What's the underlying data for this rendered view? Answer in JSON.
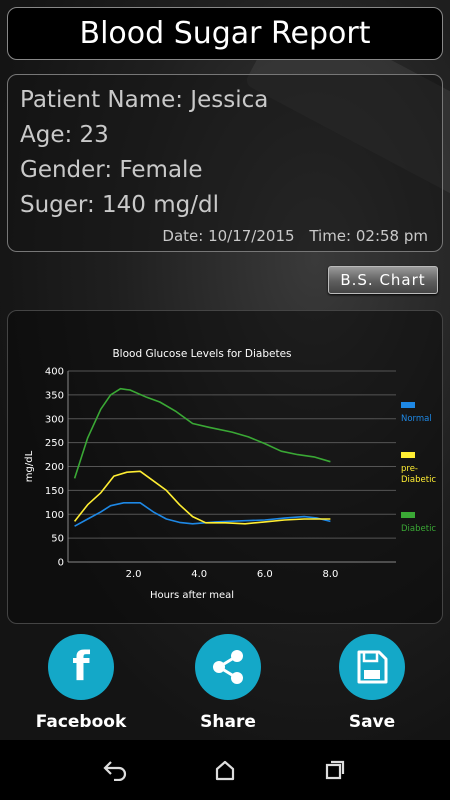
{
  "header": {
    "title": "Blood Sugar Report"
  },
  "patient": {
    "name_line": "Patient Name: Jessica",
    "age_line": "Age: 23",
    "gender_line": "Gender: Female",
    "sugar_line": "Suger: 140 mg/dl",
    "date_line": "Date: 10/17/2015",
    "time_line": "Time: 02:58 pm"
  },
  "chart_button": {
    "label": "B.S. Chart"
  },
  "chart_data": {
    "type": "line",
    "title": "Blood Glucose Levels for Diabetes",
    "xlabel": "Hours after meal",
    "ylabel": "mg/dL",
    "xlim": [
      0,
      10
    ],
    "ylim": [
      0,
      400
    ],
    "x_ticks": [
      2.0,
      4.0,
      6.0,
      8.0
    ],
    "x_tick_labels": [
      "2.0",
      "4.0",
      "6.0",
      "8.0"
    ],
    "y_ticks": [
      0,
      50,
      100,
      150,
      200,
      250,
      300,
      350,
      400
    ],
    "y_tick_labels": [
      "0",
      "50",
      "100",
      "150",
      "200",
      "250",
      "300",
      "350",
      "400"
    ],
    "grid": "horizontal",
    "legend_position": "right",
    "series": [
      {
        "name": "Normal",
        "color": "#1e88e5",
        "points": [
          [
            0.2,
            75
          ],
          [
            0.6,
            90
          ],
          [
            1.0,
            105
          ],
          [
            1.3,
            118
          ],
          [
            1.7,
            124
          ],
          [
            2.2,
            124
          ],
          [
            2.6,
            105
          ],
          [
            3.0,
            90
          ],
          [
            3.4,
            83
          ],
          [
            3.8,
            80
          ],
          [
            4.5,
            84
          ],
          [
            5.2,
            86
          ],
          [
            6.0,
            88
          ],
          [
            6.6,
            92
          ],
          [
            7.2,
            95
          ],
          [
            7.6,
            92
          ],
          [
            8.0,
            85
          ]
        ]
      },
      {
        "name": "pre-Diabetic",
        "color": "#ffee33",
        "points": [
          [
            0.2,
            85
          ],
          [
            0.6,
            120
          ],
          [
            1.0,
            145
          ],
          [
            1.4,
            180
          ],
          [
            1.8,
            188
          ],
          [
            2.2,
            190
          ],
          [
            2.6,
            170
          ],
          [
            3.0,
            150
          ],
          [
            3.4,
            120
          ],
          [
            3.8,
            95
          ],
          [
            4.2,
            82
          ],
          [
            4.8,
            82
          ],
          [
            5.4,
            80
          ],
          [
            6.0,
            84
          ],
          [
            6.6,
            88
          ],
          [
            7.2,
            90
          ],
          [
            8.0,
            90
          ]
        ]
      },
      {
        "name": "Diabetic",
        "color": "#3aa835",
        "points": [
          [
            0.2,
            175
          ],
          [
            0.6,
            260
          ],
          [
            1.0,
            320
          ],
          [
            1.3,
            350
          ],
          [
            1.6,
            363
          ],
          [
            1.9,
            360
          ],
          [
            2.4,
            345
          ],
          [
            2.8,
            335
          ],
          [
            3.3,
            315
          ],
          [
            3.8,
            290
          ],
          [
            4.3,
            282
          ],
          [
            5.0,
            272
          ],
          [
            5.5,
            262
          ],
          [
            6.0,
            248
          ],
          [
            6.5,
            232
          ],
          [
            7.0,
            225
          ],
          [
            7.5,
            220
          ],
          [
            8.0,
            210
          ]
        ]
      }
    ]
  },
  "actions": [
    {
      "label": "Facebook",
      "icon": "facebook-icon"
    },
    {
      "label": "Share",
      "icon": "share-icon"
    },
    {
      "label": "Save",
      "icon": "save-icon"
    }
  ],
  "colors": {
    "accent": "#14a8c8"
  }
}
